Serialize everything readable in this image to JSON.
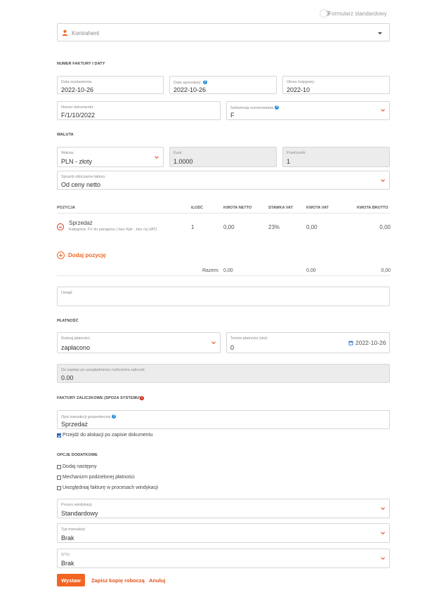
{
  "toggle": {
    "label": "Formularz standardowy"
  },
  "contractor": {
    "placeholder": "Kontrahent"
  },
  "sections": {
    "invoice": "NUMER FAKTURY I DATY",
    "currency": "WALUTA",
    "payment": "PŁATNOŚĆ",
    "advance": "FAKTURY ZALICZKOWE (SPOZA SYSTEMU)",
    "options": "OPCJE DODATKOWE"
  },
  "invoice": {
    "issue_date": {
      "label": "Data wystawienia:",
      "value": "2022-10-26"
    },
    "sale_date": {
      "label": "Data sprzedaży:",
      "value": "2022-10-26"
    },
    "period": {
      "label": "Okres księgowy:",
      "value": "2022-10"
    },
    "doc_number": {
      "label": "Numer dokumentu:",
      "value": "F/1/10/2022"
    },
    "sequence": {
      "label": "Sekwencja numerowania",
      "value": "F"
    }
  },
  "currency": {
    "currency": {
      "label": "Waluta:",
      "value": "PLN - złoty"
    },
    "rate": {
      "label": "Kurs:",
      "value": "1.0000"
    },
    "multiplier": {
      "label": "Przelicznik:",
      "value": "1"
    },
    "method": {
      "label": "Sposób obliczania faktury",
      "value": "Od ceny netto"
    }
  },
  "table": {
    "headers": {
      "position": "POZYCJA",
      "qty": "ILOŚĆ",
      "net": "KWOTA NETTO",
      "vat_rate": "STAWKA VAT",
      "vat_amount": "KWOTA VAT",
      "gross": "KWOTA BRUTTO"
    },
    "rows": [
      {
        "name": "Sprzedaż",
        "category": "Kategoria: FV do paragonu ( bez Kpir , bez rej.VAT)",
        "qty": "1",
        "net": "0,00",
        "vat_rate": "23%",
        "vat_amount": "0,00",
        "gross": "0,00"
      }
    ],
    "add_label": "Dodaj pozycję",
    "total": {
      "label": "Razem:",
      "net": "0,00",
      "vat_amount": "0,00",
      "gross": "0,00"
    }
  },
  "notes": {
    "label": "Uwagi:"
  },
  "payment": {
    "type": {
      "label": "Rodzaj płatności:",
      "value": "zapłacono"
    },
    "term": {
      "label": "Termin płatności (dni):",
      "value": "0",
      "date": "2022-10-26"
    },
    "due": {
      "label": "Do zapłaty po uwzględnieniu rozliczenia zaliczek:",
      "value": "0.00"
    }
  },
  "advance": {
    "description": {
      "label": "Opis transakcji gospodarczej",
      "value": "Sprzedaż"
    },
    "allocate_label": "Przejdź do alokacji po zapisie dokumentu",
    "allocate_checked": true
  },
  "options": {
    "checkboxes": [
      {
        "label": "Dodaj następny",
        "checked": false
      },
      {
        "label": "Mechanizm podzielonej płatności",
        "checked": false
      },
      {
        "label": "Uwzględniaj fakturę w procesach windykacji",
        "checked": false
      }
    ],
    "collection": {
      "label": "Proces windykacji",
      "value": "Standardowy"
    },
    "transaction": {
      "label": "Typ transakcji:",
      "value": "Brak"
    },
    "gtu": {
      "label": "GTU:",
      "value": "Brak"
    }
  },
  "actions": {
    "issue": "Wystaw",
    "draft": "Zapisz kopię roboczą",
    "cancel": "Anuluj"
  },
  "colors": {
    "accent": "#f26522",
    "link": "#e0521c",
    "help": "#2a8fd8",
    "danger": "#d9361a"
  }
}
